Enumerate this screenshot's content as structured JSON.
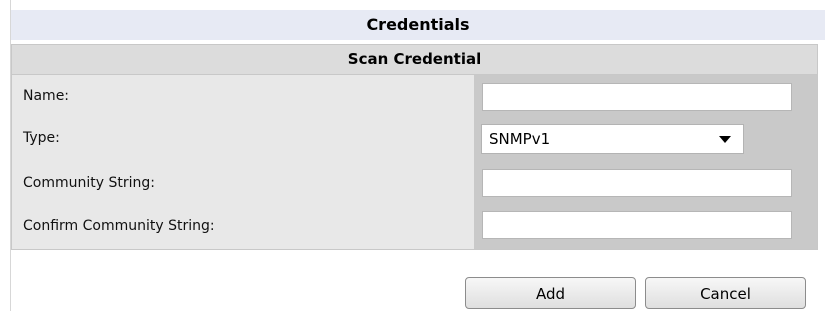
{
  "header": {
    "title": "Credentials"
  },
  "panel": {
    "title": "Scan Credential",
    "fields": {
      "name": {
        "label": "Name:",
        "value": "",
        "placeholder": ""
      },
      "type": {
        "label": "Type:",
        "selected": "SNMPv1"
      },
      "community_string": {
        "label": "Community String:",
        "value": "",
        "placeholder": ""
      },
      "confirm_community_string": {
        "label": "Confirm Community String:",
        "value": "",
        "placeholder": ""
      }
    }
  },
  "actions": {
    "add_label": "Add",
    "cancel_label": "Cancel"
  },
  "icons": {
    "dropdown": "chevron-down-icon"
  },
  "colors": {
    "header_background": "#e7eaf4",
    "panel_background": "#e8e8e8",
    "field_background": "#c9c9c9"
  }
}
